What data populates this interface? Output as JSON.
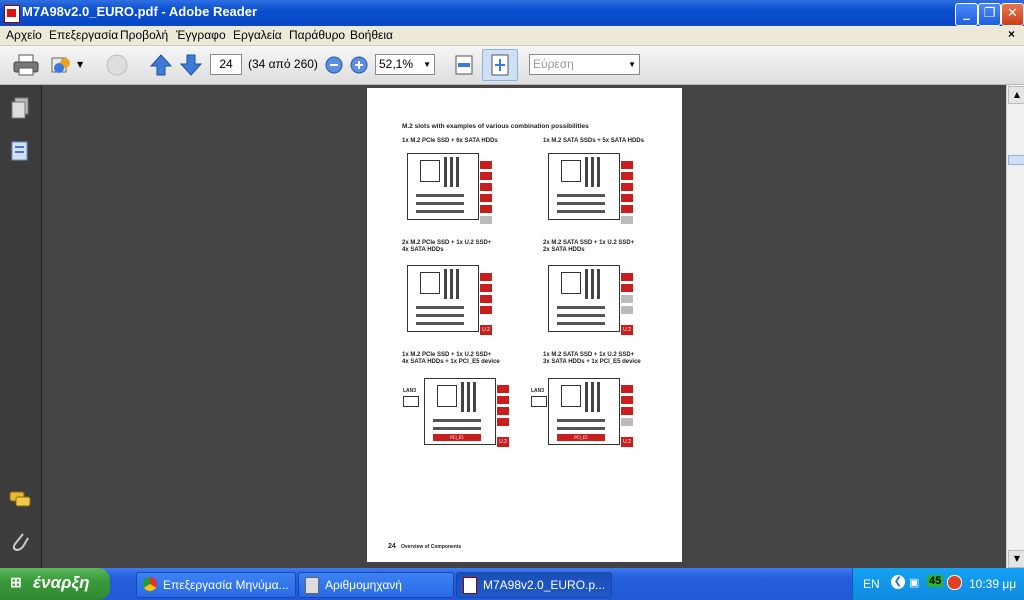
{
  "window": {
    "title": "M7A98v2.0_EURO.pdf - Adobe Reader"
  },
  "menu": [
    "Αρχείο",
    "Επεξεργασία",
    "Προβολή",
    "Έγγραφο",
    "Εργαλεία",
    "Παράθυρο",
    "Βοήθεια"
  ],
  "toolbar": {
    "page_current": "24",
    "page_total": "(34 από 260)",
    "zoom": "52,1%",
    "search_placeholder": "Εύρεση"
  },
  "page": {
    "heading": "M.2 slots with examples of various combination possibilities",
    "captions": [
      "1x M.2 PCIe SSD + 6x SATA HDDs",
      "1x M.2 SATA SSDs + 5x SATA HDDs",
      "2x M.2 PCIe SSD + 1x U.2 SSD+",
      "4x SATA HDDs",
      "2x M.2 SATA SSD + 1x U.2 SSD+",
      "2x SATA HDDs",
      "1x M.2 PCIe SSD + 1x U.2 SSD+",
      "4x SATA HDDs + 1x PCI_E5 device",
      "1x M.2 SATA SSD + 1x U.2 SSD+",
      "3x SATA HDDs + 1x PCI_E5 device"
    ],
    "u2_label": "U.2",
    "lan_label": "LAN3",
    "pcie_label": "PCI_E5",
    "footer_num": "24",
    "footer_text": "Overview of Components"
  },
  "taskbar": {
    "start": "έναρξη",
    "tasks": [
      "Επεξεργασία Μηνύμα...",
      "Αριθμομηχανή",
      "M7A98v2.0_EURO.p..."
    ],
    "lang": "EN",
    "badge": "45",
    "clock": "10:39 μμ"
  }
}
